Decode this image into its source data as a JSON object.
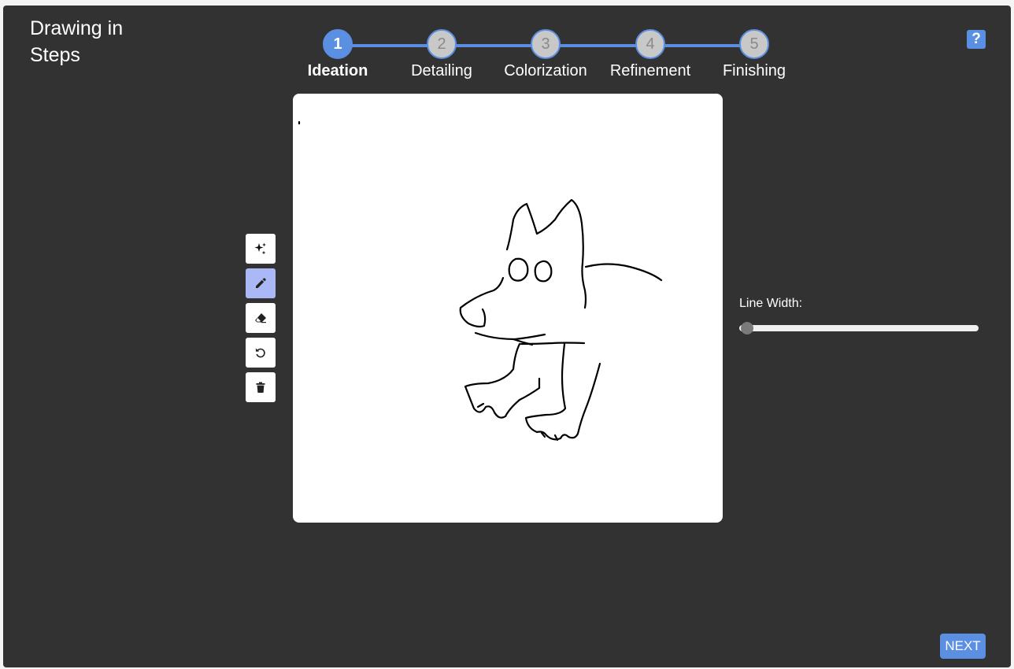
{
  "app": {
    "title": "Drawing in Steps"
  },
  "stepper": {
    "steps": [
      {
        "number": "1",
        "label": "Ideation",
        "active": true
      },
      {
        "number": "2",
        "label": "Detailing",
        "active": false
      },
      {
        "number": "3",
        "label": "Colorization",
        "active": false
      },
      {
        "number": "4",
        "label": "Refinement",
        "active": false
      },
      {
        "number": "5",
        "label": "Finishing",
        "active": false
      }
    ],
    "accent_color": "#5a8fe2"
  },
  "help": {
    "label": "?"
  },
  "tools": [
    {
      "name": "ai-sparkle",
      "icon": "sparkle-icon",
      "active": false
    },
    {
      "name": "pencil",
      "icon": "pencil-icon",
      "active": true
    },
    {
      "name": "eraser",
      "icon": "eraser-icon",
      "active": false
    },
    {
      "name": "undo",
      "icon": "undo-icon",
      "active": false
    },
    {
      "name": "clear",
      "icon": "trash-icon",
      "active": false
    }
  ],
  "line_width": {
    "label": "Line Width:",
    "value_fraction": 0.0
  },
  "footer": {
    "next_label": "NEXT"
  },
  "colors": {
    "background": "#323232",
    "canvas": "#ffffff",
    "active_tool": "#aab9f5"
  }
}
